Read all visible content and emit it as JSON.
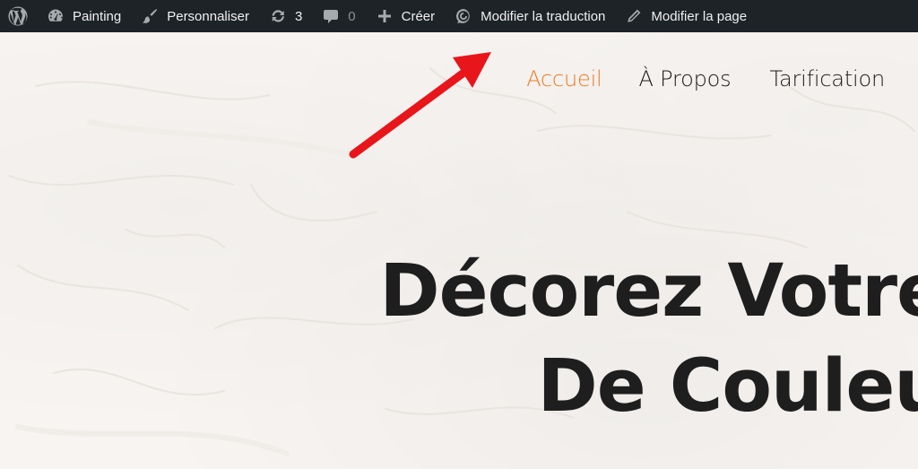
{
  "admin_bar": {
    "items": [
      {
        "label": "",
        "icon": "wordpress-logo-icon"
      },
      {
        "label": "Painting",
        "icon": "dashboard-gauge-icon"
      },
      {
        "label": "Personnaliser",
        "icon": "paintbrush-icon"
      },
      {
        "label": "3",
        "icon": "update-sync-icon"
      },
      {
        "label": "0",
        "icon": "comment-bubble-icon"
      },
      {
        "label": "Créer",
        "icon": "plus-icon"
      },
      {
        "label": "Modifier la traduction",
        "icon": "translate-icon"
      },
      {
        "label": "Modifier la page",
        "icon": "pencil-icon"
      }
    ],
    "background": "#1d2327",
    "icon_color": "#a7aaad"
  },
  "nav": {
    "items": [
      {
        "label": "Accueil",
        "active": true
      },
      {
        "label": "À Propos"
      },
      {
        "label": "Tarification"
      }
    ],
    "active_color": "#ef7a23"
  },
  "hero": {
    "line1": "Décorez Votre",
    "line2": "De Couleu"
  },
  "annotation": {
    "arrow_color": "#e8151b"
  }
}
